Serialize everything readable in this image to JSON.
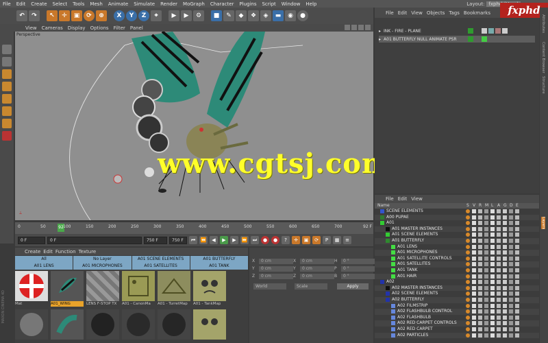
{
  "menu": [
    "File",
    "Edit",
    "Create",
    "Select",
    "Tools",
    "Mesh",
    "Animate",
    "Simulate",
    "Render",
    "MoGraph",
    "Character",
    "Plugins",
    "Script",
    "Window",
    "Help"
  ],
  "layout_label": "Layout:",
  "layout_value": "fxphd (User)",
  "toolbar_axis": [
    "X",
    "Y",
    "Z"
  ],
  "viewport_menu": [
    "View",
    "Cameras",
    "Display",
    "Options",
    "Filter",
    "Panel"
  ],
  "viewport_label": "Perspective",
  "watermark": "www.cgtsj.com",
  "timeline": {
    "ticks": [
      "0",
      "50",
      "100",
      "150",
      "200",
      "250",
      "300",
      "350",
      "400",
      "450",
      "500",
      "550",
      "600",
      "650",
      "700"
    ],
    "current": "92",
    "end": "92 F"
  },
  "transport": {
    "start": "0 F",
    "min": "0 F",
    "max": "750 F",
    "end": "750 F"
  },
  "material_menu": [
    "Create",
    "Edit",
    "Function",
    "Texture"
  ],
  "material_filters_row1": [
    "All",
    "No Layer",
    "A01 SCENE ELEMENTS",
    "A01 BUTTERFLY"
  ],
  "material_filters_row2": [
    "A01 LENS",
    "A01 MICROPHONES",
    "A01 SATELLITES",
    "A01 TANK"
  ],
  "materials": [
    "Mat",
    "A01_WING",
    "LENS F-STOP TX",
    "A01 - CanonMa",
    "A01 - TurretMap",
    "A01 - TankMap"
  ],
  "attributes": {
    "labels": [
      "X",
      "Y",
      "Z",
      "X",
      "Y",
      "Z",
      "H",
      "P",
      "B"
    ],
    "values": [
      "0 cm",
      "0 cm",
      "0 cm",
      "0 cm",
      "0 cm",
      "0 cm",
      "0 °",
      "0 °",
      "0 °"
    ],
    "coord_mode": "World",
    "scale_mode": "Scale",
    "apply": "Apply"
  },
  "object_manager": {
    "menu": [
      "File",
      "Edit",
      "View",
      "Objects",
      "Tags",
      "Bookmarks"
    ],
    "rows": [
      "INK - FIRE - PLANE",
      "A01 BUTTERFLY NULL ANIMATE PSR"
    ]
  },
  "layer_manager": {
    "menu": [
      "File",
      "Edit",
      "View"
    ],
    "header_name": "Name",
    "header_cols": [
      "S",
      "V",
      "R",
      "M",
      "L",
      "A",
      "G",
      "D",
      "E"
    ],
    "rows": [
      {
        "name": "SCENE ELEMENTS",
        "indent": 1,
        "color": "#3355cc"
      },
      {
        "name": "A00 PUPAE",
        "indent": 1,
        "color": "#2f7a2f"
      },
      {
        "name": "A01",
        "indent": 1,
        "color": "#33cc33"
      },
      {
        "name": "A01 MASTER INSTANCES",
        "indent": 2,
        "color": "#111111"
      },
      {
        "name": "A01 SCENE ELEMENTS",
        "indent": 2,
        "color": "#33cc33"
      },
      {
        "name": "A01 BUTTERFLY",
        "indent": 2,
        "color": "#2f8a2f"
      },
      {
        "name": "A01 LENS",
        "indent": 3,
        "color": "#44dd44"
      },
      {
        "name": "A01 MICROPHONES",
        "indent": 3,
        "color": "#44dd44"
      },
      {
        "name": "A01 SATELLITE CONTROLS",
        "indent": 3,
        "color": "#44dd44"
      },
      {
        "name": "A01 SATELLITES",
        "indent": 3,
        "color": "#44dd44"
      },
      {
        "name": "A01 TANK",
        "indent": 3,
        "color": "#44dd44"
      },
      {
        "name": "A01 HAIR",
        "indent": 3,
        "color": "#44dd44"
      },
      {
        "name": "A02",
        "indent": 1,
        "color": "#2233aa"
      },
      {
        "name": "A02 MASTER INSTANCES",
        "indent": 2,
        "color": "#111111"
      },
      {
        "name": "A02 SCENE ELEMENTS",
        "indent": 2,
        "color": "#2233aa"
      },
      {
        "name": "A02 BUTTERFLY",
        "indent": 2,
        "color": "#2233aa"
      },
      {
        "name": "A02 FILMSTRIP",
        "indent": 3,
        "color": "#6688dd"
      },
      {
        "name": "A02 FLASHBULB CONTROL",
        "indent": 3,
        "color": "#6688dd"
      },
      {
        "name": "A02 FLASHBULB",
        "indent": 3,
        "color": "#6688dd"
      },
      {
        "name": "A02 RED CARPET CONTROLS",
        "indent": 3,
        "color": "#6688dd"
      },
      {
        "name": "A02 RED CARPET",
        "indent": 3,
        "color": "#6688dd"
      },
      {
        "name": "A02 PARTICLES",
        "indent": 3,
        "color": "#6688dd"
      }
    ]
  },
  "sidebar_tabs": [
    "Attributes",
    "Content Browser",
    "Structure",
    "Layers"
  ],
  "brand": "fxphd",
  "maxon": "MAXON CINEMA 4D"
}
